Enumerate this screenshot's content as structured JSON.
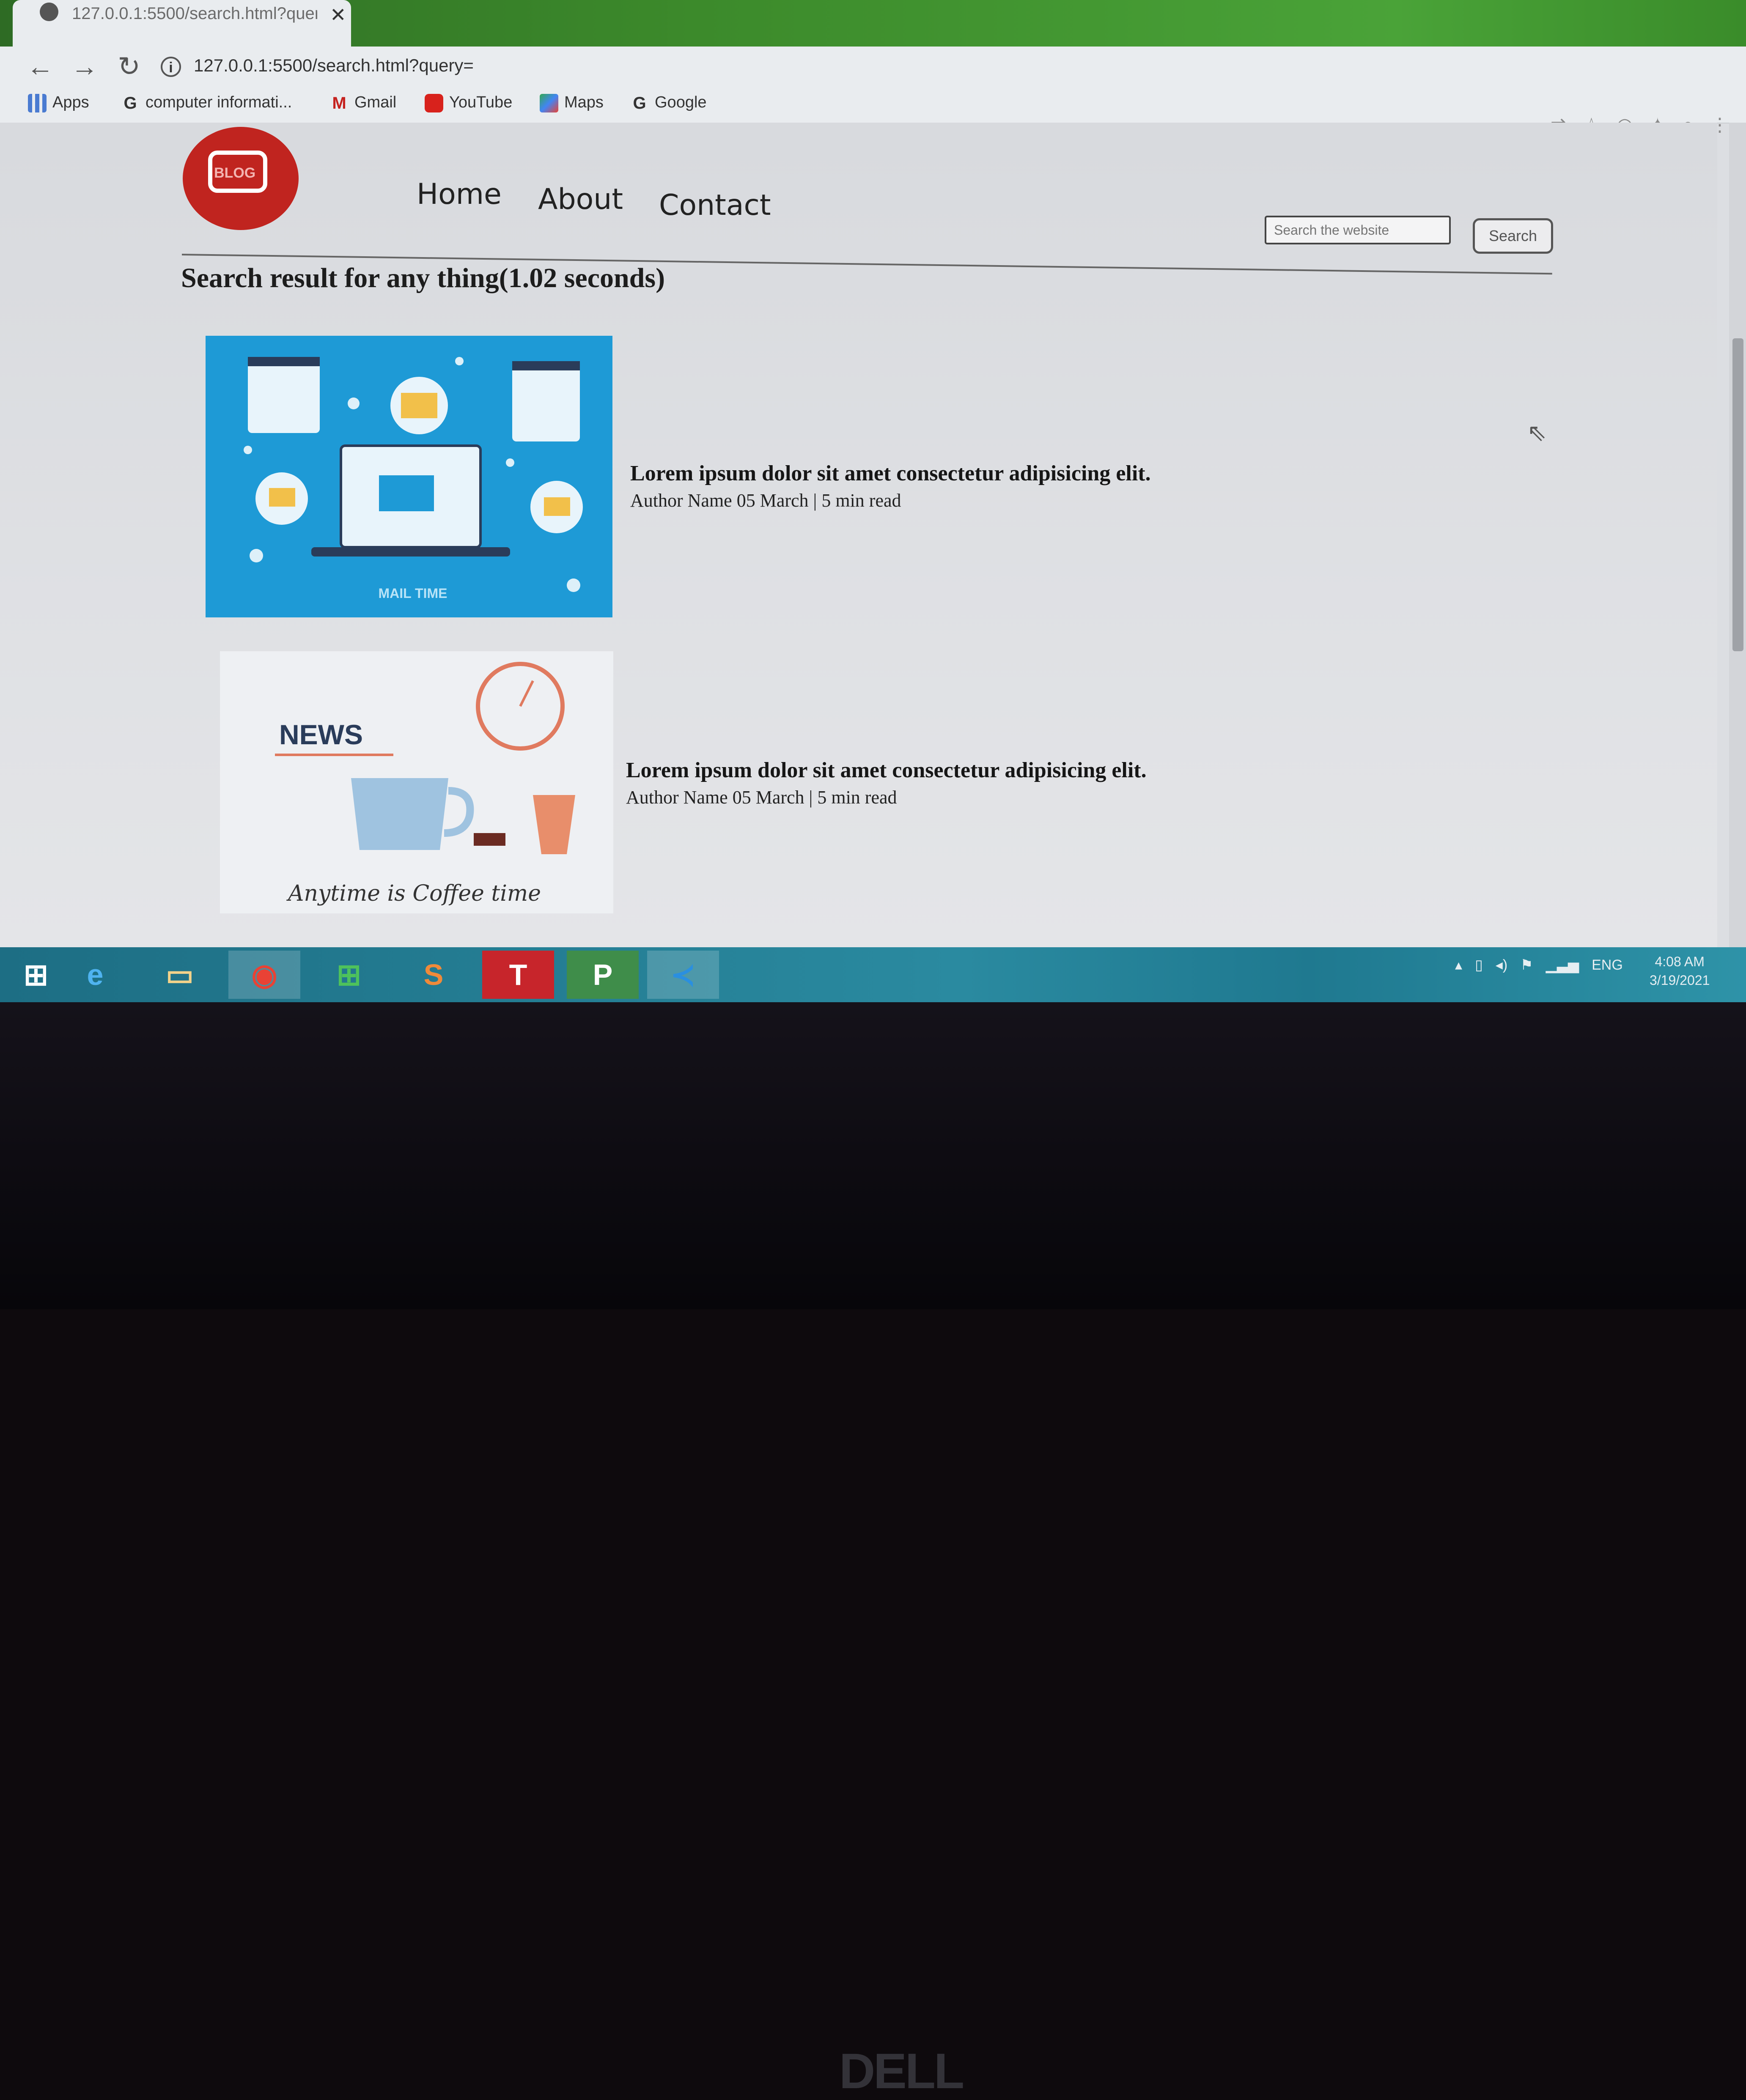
{
  "browser": {
    "tab_title": "127.0.0.1:5500/search.html?quer",
    "tab_close": "✕",
    "url": "127.0.0.1:5500/search.html?query=",
    "back": "←",
    "forward": "→",
    "reload": "↻",
    "bookmarks": [
      {
        "label": "Apps",
        "icon": "apps-grid-icon"
      },
      {
        "label": "computer informati...",
        "icon": "google-g-icon"
      },
      {
        "label": "Gmail",
        "icon": "gmail-icon"
      },
      {
        "label": "YouTube",
        "icon": "youtube-icon"
      },
      {
        "label": "Maps",
        "icon": "maps-icon"
      },
      {
        "label": "Google",
        "icon": "google-g-icon"
      }
    ],
    "toolbar_icons": [
      "translate-icon",
      "star-icon",
      "camera-icon",
      "puzzle-icon",
      "profile-icon",
      "menu-dots-icon"
    ]
  },
  "site": {
    "logo_text": "BLOG",
    "nav": [
      "Home",
      "About",
      "Contact"
    ],
    "search_placeholder": "Search the website",
    "search_button": "Search",
    "heading": "Search result for any thing(1.02 seconds)",
    "results": [
      {
        "title": "Lorem ipsum dolor sit amet consectetur adipisicing elit.",
        "meta": "Author Name 05 March | 5 min read",
        "image_caption": "MAIL TIME"
      },
      {
        "title": "Lorem ipsum dolor sit amet consectetur adipisicing elit.",
        "meta": "Author Name 05 March | 5 min read",
        "image_heading": "NEWS",
        "image_caption": "Anytime is Coffee time"
      }
    ]
  },
  "taskbar": {
    "apps": [
      "windows-start-icon",
      "internet-explorer-icon",
      "file-explorer-icon",
      "chrome-icon",
      "store-icon",
      "sway-icon",
      "teams-icon",
      "project-icon",
      "vscode-icon"
    ],
    "tray_lang": "ENG",
    "time": "4:08 AM",
    "date": "3/19/2021"
  },
  "bezel": {
    "brand": "DELL"
  }
}
